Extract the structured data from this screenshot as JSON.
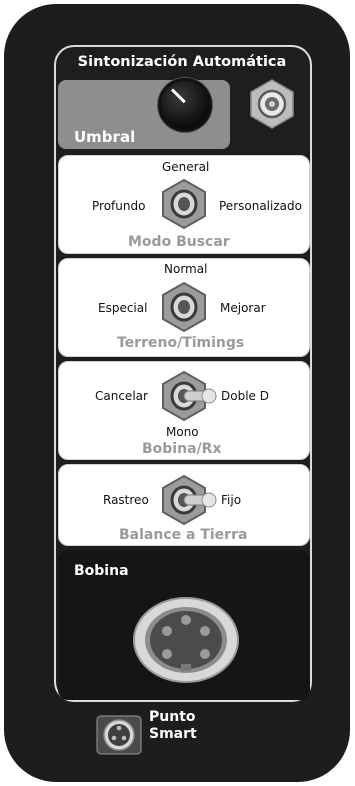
{
  "header": {
    "title": "Sintonización Automática"
  },
  "threshold": {
    "label": "Umbral"
  },
  "search_mode": {
    "label": "Modo Buscar",
    "options": {
      "top": "General",
      "left": "Profundo",
      "right": "Personalizado"
    }
  },
  "ground_timings": {
    "label": "Terreno/Timings",
    "options": {
      "top": "Normal",
      "left": "Especial",
      "right": "Mejorar"
    }
  },
  "coil_rx": {
    "label": "Bobina/Rx",
    "options": {
      "left": "Cancelar",
      "right": "Doble D",
      "bottom": "Mono"
    }
  },
  "ground_balance": {
    "label": "Balance a Tierra",
    "options": {
      "left": "Rastreo",
      "right": "Fijo"
    }
  },
  "coil": {
    "label": "Bobina"
  },
  "smart_point": {
    "line1": "Punto",
    "line2": "Smart"
  }
}
